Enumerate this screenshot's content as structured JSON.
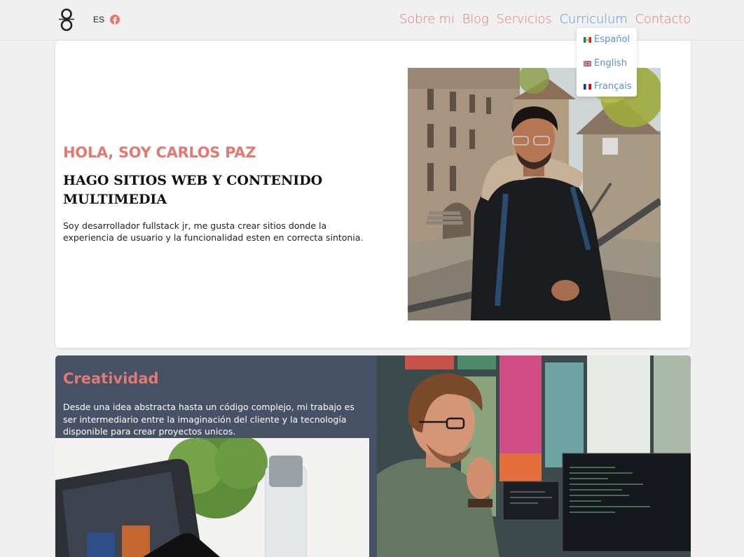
{
  "header": {
    "lang_code": "ES",
    "nav": [
      {
        "label": "Sobre mi"
      },
      {
        "label": "Blog"
      },
      {
        "label": "Servicios"
      },
      {
        "label": "Curriculum"
      },
      {
        "label": "Contacto"
      }
    ],
    "dropdown": [
      {
        "label": "Español",
        "flag": "mexico-flag"
      },
      {
        "label": "English",
        "flag": "uk-flag"
      },
      {
        "label": "Français",
        "flag": "france-flag"
      }
    ]
  },
  "hero": {
    "greeting": "HOLA, SOY CARLOS PAZ",
    "title": "HAGO SITIOS WEB Y CONTENIDO MULTIMEDIA",
    "text": "Soy desarrollador fullstack jr, me gusta crear sitios donde la experiencia de usuario y la funcionalidad esten en correcta sintonia."
  },
  "creative": {
    "title": "Creatividad",
    "text": "Desde una idea abstracta hasta un código complejo, mi trabajo es ser intermediario entre la imaginación del cliente y la tecnología disponible para crear proyectos unicos."
  },
  "colors": {
    "accent": "#e07a73",
    "link_active": "#5b8fd6",
    "dark_panel": "#475266",
    "background": "#f0f0f0"
  }
}
